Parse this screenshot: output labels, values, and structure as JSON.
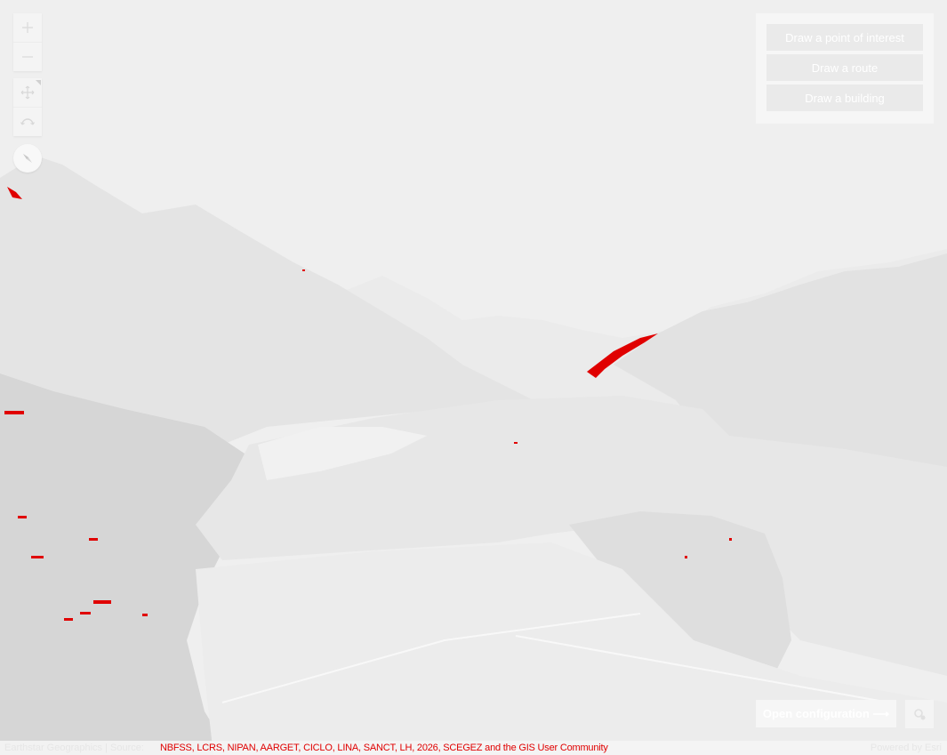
{
  "map": {
    "zoom_in_icon": "plus-icon",
    "zoom_out_icon": "minus-icon",
    "pan_icon": "move-arrows-icon",
    "rotate_icon": "rotate-icon",
    "compass_icon": "compass-needle-icon"
  },
  "draw_panel": {
    "buttons": [
      {
        "label": "Draw a point of interest"
      },
      {
        "label": "Draw a route"
      },
      {
        "label": "Draw a building"
      }
    ]
  },
  "bottom": {
    "config_label": "Open configuration ⟶",
    "locate_icon": "locate-gear-icon"
  },
  "attribution": {
    "left_text": "Earthstar Geographics | Source:",
    "overlay_text": "NBFSS, LCRS, NIPAN, AARGET, CICLO, LINA, SANCT, LH, 2026, SCEGEZ and the GIS User Community",
    "powered_text": "Powered by Esri"
  },
  "colors": {
    "annotation_red": "#e00000",
    "muted_white": "#ffffff"
  }
}
